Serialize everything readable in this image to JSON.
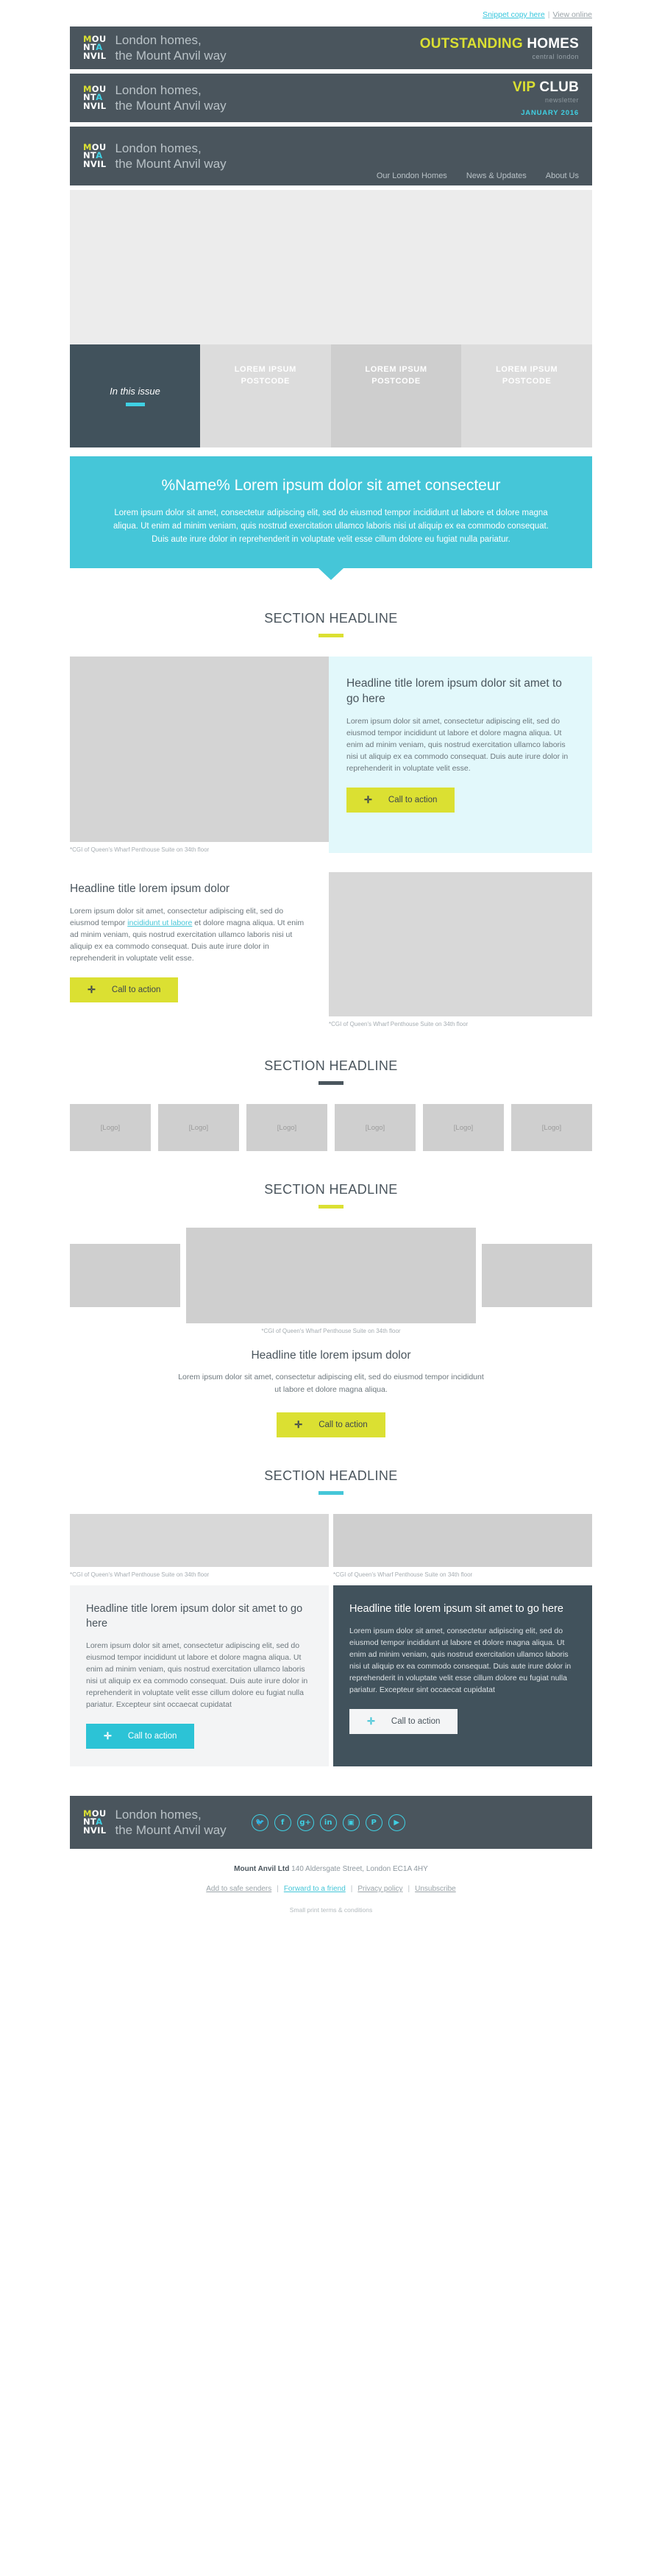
{
  "preheader": {
    "snippet_label": "Snippet copy here",
    "separator": "|",
    "view_online_label": "View online"
  },
  "brand": {
    "logo_line1_a": "M",
    "logo_line1_b": "OU",
    "logo_line2_a": "NT",
    "logo_line2_b": "A",
    "logo_line3": "NVIL",
    "tagline_line1": "London homes,",
    "tagline_line2": "the Mount Anvil way"
  },
  "banner1": {
    "title_strong": "OUTSTANDING",
    "title_rest": " HOMES",
    "subtitle": "central london"
  },
  "banner2": {
    "title_strong": "VIP",
    "title_rest": " CLUB",
    "subtitle": "newsletter",
    "date": "JANUARY 2016"
  },
  "banner3": {
    "nav": [
      "Our London Homes",
      "News & Updates",
      "About Us"
    ]
  },
  "issue": {
    "label": "In this issue",
    "cells": [
      "LOREM IPSUM\nPOSTCODE",
      "LOREM IPSUM\nPOSTCODE",
      "LOREM IPSUM\nPOSTCODE"
    ],
    "cell_line1": "LOREM IPSUM",
    "cell_line2": "POSTCODE"
  },
  "intro": {
    "headline": "%Name% Lorem ipsum dolor sit amet consecteur",
    "body": "Lorem ipsum dolor sit amet, consectetur adipiscing elit, sed do eiusmod tempor incididunt ut labore et dolore magna aliqua. Ut enim ad minim veniam, quis nostrud exercitation ullamco laboris nisi ut aliquip ex ea commodo consequat. Duis aute irure dolor in reprehenderit in voluptate velit esse cillum dolore eu fugiat nulla pariatur."
  },
  "sections": {
    "headline": "SECTION HEADLINE"
  },
  "caption": "*CGI of Queen's Wharf Penthouse Suite on 34th floor",
  "cta_label": "Call to action",
  "cta_plus": "✛",
  "feature1": {
    "title": "Headline title lorem ipsum dolor sit amet  to go here",
    "body": "Lorem ipsum dolor sit amet, consectetur adipiscing elit, sed do eiusmod tempor incididunt ut labore et dolore magna aliqua. Ut enim ad minim veniam, quis nostrud exercitation ullamco laboris nisi ut aliquip ex ea commodo consequat. Duis aute irure dolor in reprehenderit in voluptate velit esse."
  },
  "feature2": {
    "title": "Headline title lorem ipsum dolor",
    "body_part1": "Lorem ipsum dolor sit amet, consectetur adipiscing elit, sed do eiusmod tempor ",
    "body_link": "incididunt ut labore",
    "body_part2": " et dolore magna aliqua. Ut enim ad minim veniam, quis nostrud exercitation ullamco laboris nisi ut aliquip ex ea commodo consequat. Duis aute irure dolor in reprehenderit in voluptate velit esse."
  },
  "logos": {
    "items": [
      "[Logo]",
      "[Logo]",
      "[Logo]",
      "[Logo]",
      "[Logo]",
      "[Logo]"
    ]
  },
  "gallery_block": {
    "title": "Headline title lorem ipsum dolor",
    "body": "Lorem ipsum dolor sit amet, consectetur adipiscing elit, sed do eiusmod tempor incididunt ut labore et dolore magna aliqua."
  },
  "twocol": {
    "left": {
      "title": "Headline title lorem ipsum dolor sit amet  to go here",
      "body": "Lorem ipsum dolor sit amet, consectetur adipiscing elit, sed do eiusmod tempor incididunt ut labore et dolore magna aliqua. Ut enim ad minim veniam, quis nostrud exercitation ullamco laboris nisi ut aliquip ex ea commodo consequat. Duis aute irure dolor in reprehenderit in voluptate velit esse cillum dolore eu fugiat nulla pariatur. Excepteur sint occaecat cupidatat"
    },
    "right": {
      "title": "Headline title lorem ipsum sit amet  to go here",
      "body": "Lorem ipsum dolor sit amet, consectetur adipiscing elit, sed do eiusmod tempor incididunt ut labore et dolore magna aliqua. Ut enim ad minim veniam, quis nostrud exercitation ullamco laboris nisi ut aliquip ex ea commodo consequat. Duis aute irure dolor in reprehenderit in voluptate velit esse cillum dolore eu fugiat nulla pariatur. Excepteur sint occaecat cupidatat"
    }
  },
  "footer": {
    "social": [
      {
        "name": "twitter",
        "glyph": "🐦"
      },
      {
        "name": "facebook",
        "glyph": "f"
      },
      {
        "name": "google-plus",
        "glyph": "g+"
      },
      {
        "name": "linkedin",
        "glyph": "in"
      },
      {
        "name": "instagram",
        "glyph": "▣"
      },
      {
        "name": "pinterest",
        "glyph": "P"
      },
      {
        "name": "youtube",
        "glyph": "▶"
      }
    ],
    "company": "Mount Anvil Ltd",
    "address": " 140 Aldersgate Street, London EC1A 4HY",
    "links": [
      "Add to safe senders",
      "Forward to a friend",
      "Privacy policy",
      "Unsubscribe"
    ],
    "separator": "|",
    "small_print": "Small print terms & conditions"
  },
  "colors": {
    "slate": "#4a555d",
    "slate_dark": "#41525c",
    "cyan": "#45c6d8",
    "cyan_light": "#e2f8fb",
    "yellow": "#dbe032",
    "grey_img": "#cfcfcf"
  }
}
